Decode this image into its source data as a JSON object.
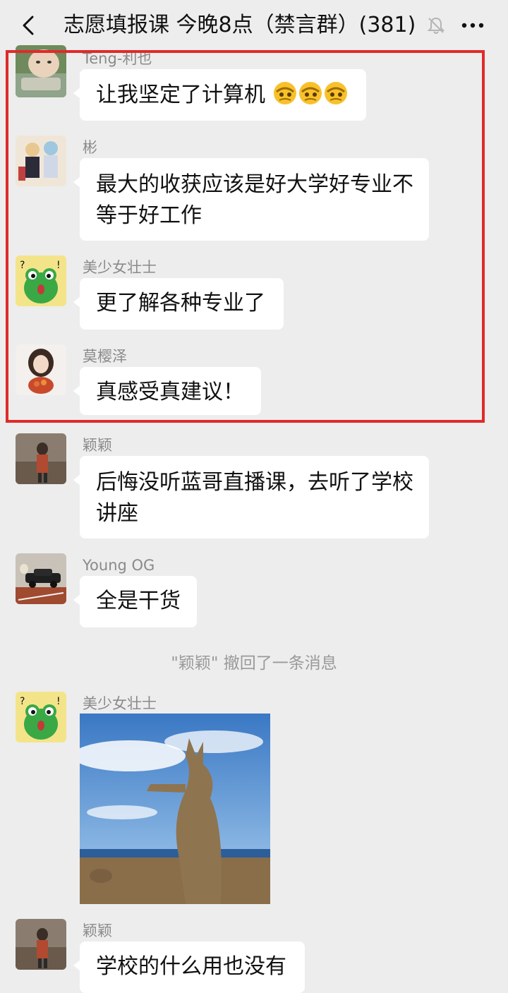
{
  "header": {
    "title": "志愿填报课 今晚8点（禁言群）(381)"
  },
  "messages": [
    {
      "sender": "Teng-利也",
      "lines": [
        "让我坚定了计算机"
      ],
      "emoji_count": 3
    },
    {
      "sender": "彬",
      "lines": [
        "最大的收获应该是好大学好专业不",
        "等于好工作"
      ]
    },
    {
      "sender": "美少女壮士",
      "lines": [
        "更了解各种专业了"
      ]
    },
    {
      "sender": "莫樱泽",
      "lines": [
        "真感受真建议！"
      ]
    },
    {
      "sender": "颖颖",
      "lines": [
        "后悔没听蓝哥直播课，去听了学校",
        "讲座"
      ]
    },
    {
      "sender": "Young OG",
      "lines": [
        "全是干货"
      ]
    },
    {
      "sender": "美少女壮士",
      "lines": []
    },
    {
      "sender": "颖颖",
      "lines": [
        "学校的什么用也没有"
      ]
    }
  ],
  "system_notice": "\"颖颖\" 撤回了一条消息",
  "colors": {
    "background": "#ededed",
    "bubble": "#ffffff",
    "highlight_border": "#e02a2a",
    "sender_text": "#8a8a8a"
  }
}
